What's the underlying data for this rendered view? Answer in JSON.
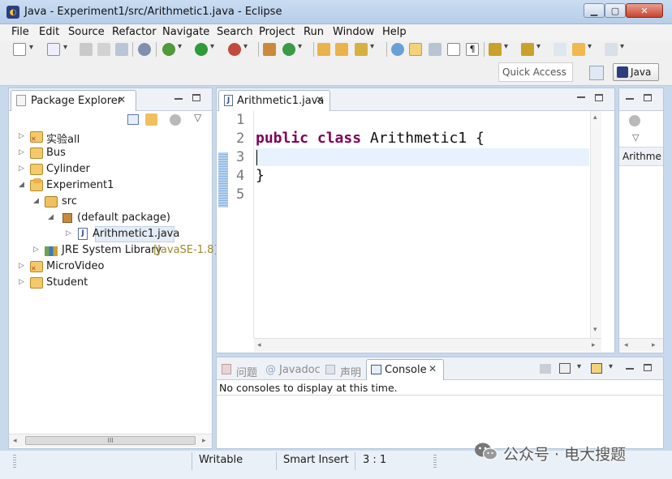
{
  "window": {
    "title": "Java - Experiment1/src/Arithmetic1.java - Eclipse"
  },
  "menu": [
    "File",
    "Edit",
    "Source",
    "Refactor",
    "Navigate",
    "Search",
    "Project",
    "Run",
    "Window",
    "Help"
  ],
  "toolbar": {
    "quick_access": "Quick Access",
    "perspective": "Java"
  },
  "package_explorer": {
    "tab": "Package Explorer",
    "items": [
      {
        "label": "实验all",
        "icon": "project-error-icon",
        "depth": 0,
        "expanded": false
      },
      {
        "label": "Bus",
        "icon": "project-icon",
        "depth": 0,
        "expanded": false
      },
      {
        "label": "Cylinder",
        "icon": "project-icon",
        "depth": 0,
        "expanded": false
      },
      {
        "label": "Experiment1",
        "icon": "project-open-icon",
        "depth": 0,
        "expanded": true
      },
      {
        "label": "src",
        "icon": "source-folder-icon",
        "depth": 1,
        "expanded": true
      },
      {
        "label": "(default package)",
        "icon": "package-icon",
        "depth": 2,
        "expanded": true
      },
      {
        "label": "Arithmetic1.java",
        "icon": "java-file-icon",
        "depth": 3,
        "expanded": false,
        "selected": true
      },
      {
        "label": "JRE System Library",
        "extra": "[JavaSE-1.8]",
        "icon": "library-icon",
        "depth": 1,
        "expanded": false
      },
      {
        "label": "MicroVideo",
        "icon": "project-error-icon",
        "depth": 0,
        "expanded": false
      },
      {
        "label": "Student",
        "icon": "project-icon",
        "depth": 0,
        "expanded": false
      }
    ],
    "scroll_label": "III"
  },
  "editor": {
    "tab": "Arithmetic1.java",
    "line_numbers": [
      "1",
      "2",
      "3",
      "4",
      "5"
    ],
    "code": {
      "kw1": "public",
      "kw2": "class",
      "classname": "Arithmetic1 {",
      "closing": "}"
    }
  },
  "outline": {
    "label": "Arithme"
  },
  "console": {
    "tabs": {
      "problems": "问题",
      "javadoc": "Javadoc",
      "declaration": "声明",
      "console": "Console"
    },
    "message": "No consoles to display at this time."
  },
  "status": {
    "writable": "Writable",
    "insert_mode": "Smart Insert",
    "position": "3 : 1"
  },
  "watermark": "公众号 · 电大搜题",
  "colors": {
    "keyword": "#7f0055",
    "current_line": "#e8f2fe",
    "chrome": "#c8d9ee"
  }
}
